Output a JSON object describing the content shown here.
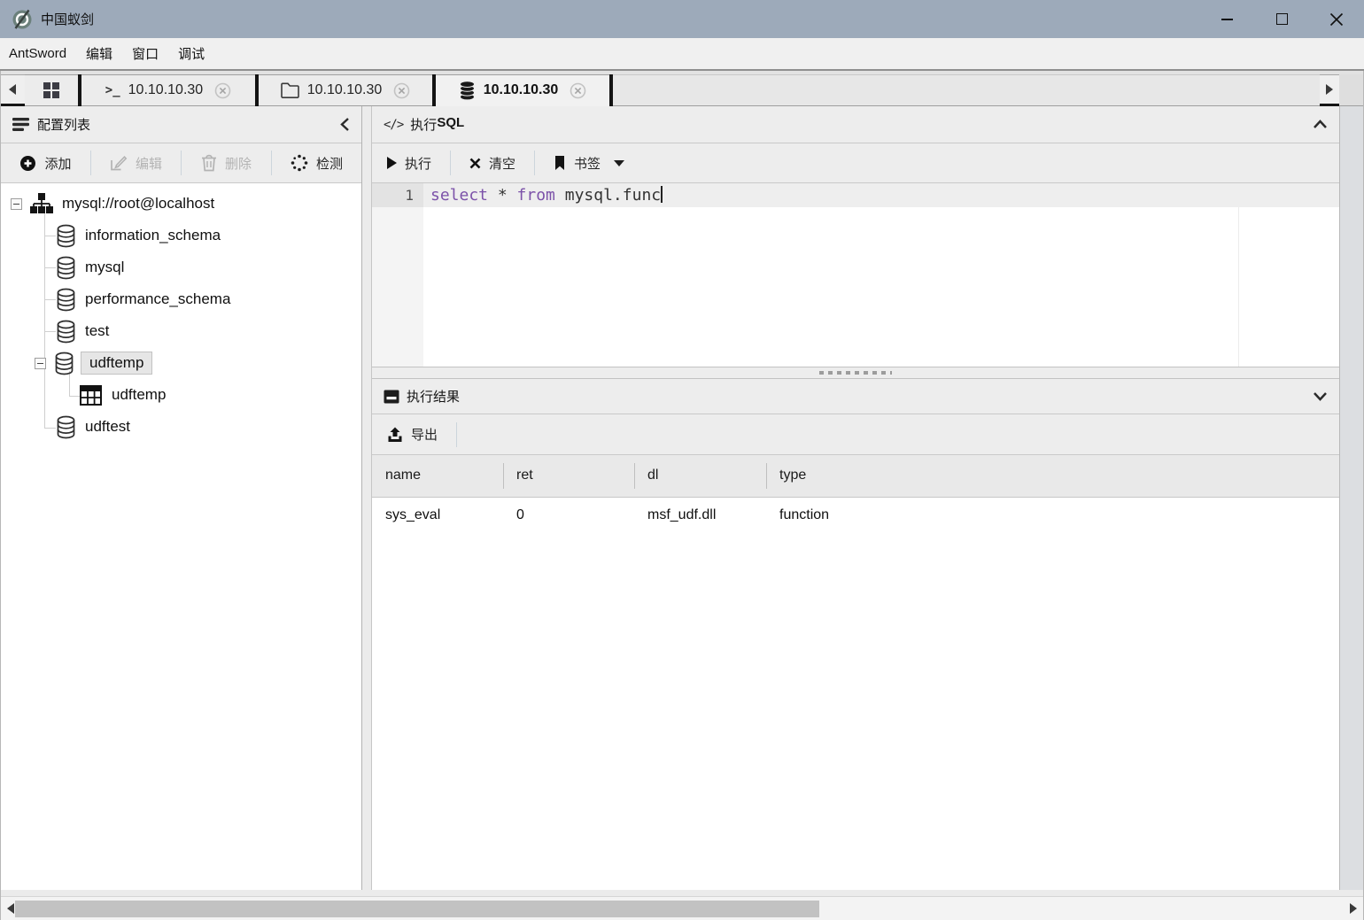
{
  "window": {
    "title": "中国蚁剑"
  },
  "menu": {
    "items": [
      {
        "label": "AntSword"
      },
      {
        "label": "编辑"
      },
      {
        "label": "窗口"
      },
      {
        "label": "调试"
      }
    ]
  },
  "tabbar": {
    "terminal_glyph": ">_",
    "tabs": [
      {
        "name": "home",
        "label": ""
      },
      {
        "name": "terminal",
        "label": "10.10.10.30",
        "closable": true
      },
      {
        "name": "file-manager",
        "label": "10.10.10.30",
        "closable": true
      },
      {
        "name": "database",
        "label": "10.10.10.30",
        "closable": true,
        "active": true
      }
    ]
  },
  "sidebar": {
    "title": "配置列表",
    "toolbar": {
      "add": "添加",
      "edit": "编辑",
      "delete": "删除",
      "check": "检测"
    },
    "tree": {
      "items": [
        {
          "label": "mysql://root@localhost",
          "type": "connection",
          "expanded": true
        },
        {
          "label": "information_schema",
          "type": "database"
        },
        {
          "label": "mysql",
          "type": "database"
        },
        {
          "label": "performance_schema",
          "type": "database"
        },
        {
          "label": "test",
          "type": "database"
        },
        {
          "label": "udftemp",
          "type": "database",
          "selected": true,
          "expanded": true
        },
        {
          "label": "udftemp",
          "type": "table"
        },
        {
          "label": "udftest",
          "type": "database"
        }
      ]
    }
  },
  "sql_panel": {
    "header_glyph": "</>",
    "title_prefix": "执行",
    "title_suffix": "SQL",
    "toolbar": {
      "execute": "执行",
      "clear": "清空",
      "bookmark": "书签"
    },
    "editor": {
      "line_number": "1",
      "code": "select * from mysql.func",
      "tokens": [
        {
          "text": "select",
          "type": "keyword"
        },
        {
          "text": " * ",
          "type": "plain"
        },
        {
          "text": "from",
          "type": "keyword"
        },
        {
          "text": " mysql.func",
          "type": "plain"
        }
      ]
    }
  },
  "result_panel": {
    "title": "执行结果",
    "toolbar": {
      "export": "导出"
    },
    "table": {
      "columns": [
        "name",
        "ret",
        "dl",
        "type"
      ],
      "rows": [
        {
          "name": "sys_eval",
          "ret": "0",
          "dl": "msf_udf.dll",
          "type": "function"
        }
      ]
    }
  },
  "icons": {
    "app_logo": "antsword-logo-icon",
    "tab_home": "grid-icon",
    "tab_terminal": "terminal-icon",
    "tab_files": "folder-icon",
    "tab_database": "database-icon",
    "tab_close": "circle-x-icon",
    "sidebar_header": "list-icon",
    "add": "plus-circle-icon",
    "edit": "pencil-icon",
    "delete": "trash-icon",
    "check": "spinner-dots-icon",
    "execute": "play-icon",
    "clear": "x-icon",
    "bookmark": "bookmark-icon",
    "export": "upload-icon",
    "sql_header": "code-icon",
    "result_header": "inbox-icon"
  },
  "colors": {
    "titlebar": "#9daaba",
    "panel_bg": "#ededed",
    "keyword_purple": "#7c52a9",
    "selected_tree_bg": "#e6e6e6",
    "scrollbar_thumb": "#c2c2c2"
  }
}
